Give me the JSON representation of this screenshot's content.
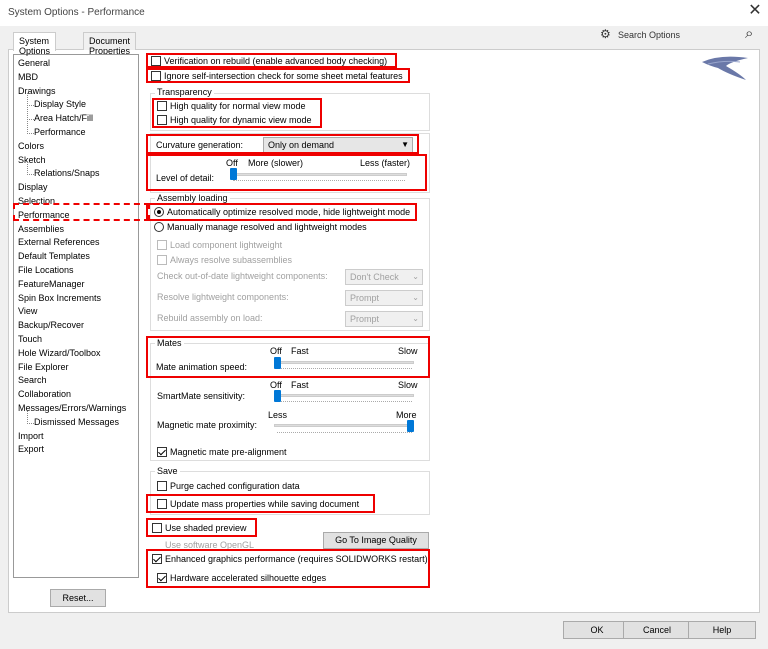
{
  "window": {
    "title": "System Options - Performance",
    "close_glyph": "✕"
  },
  "tabs": [
    {
      "label": "System Options",
      "active": true
    },
    {
      "label": "Document Properties",
      "active": false
    }
  ],
  "search": {
    "label": "Search Options",
    "icon": "gear-icon"
  },
  "tree": {
    "items": [
      {
        "label": "General",
        "sub": false
      },
      {
        "label": "MBD",
        "sub": false
      },
      {
        "label": "Drawings",
        "sub": false
      },
      {
        "label": "Display Style",
        "sub": true
      },
      {
        "label": "Area Hatch/Fill",
        "sub": true
      },
      {
        "label": "Performance",
        "sub": true
      },
      {
        "label": "Colors",
        "sub": false
      },
      {
        "label": "Sketch",
        "sub": false
      },
      {
        "label": "Relations/Snaps",
        "sub": true
      },
      {
        "label": "Display",
        "sub": false
      },
      {
        "label": "Selection",
        "sub": false
      },
      {
        "label": "Performance",
        "sub": false,
        "selected": true
      },
      {
        "label": "Assemblies",
        "sub": false
      },
      {
        "label": "External References",
        "sub": false
      },
      {
        "label": "Default Templates",
        "sub": false
      },
      {
        "label": "File Locations",
        "sub": false
      },
      {
        "label": "FeatureManager",
        "sub": false
      },
      {
        "label": "Spin Box Increments",
        "sub": false
      },
      {
        "label": "View",
        "sub": false
      },
      {
        "label": "Backup/Recover",
        "sub": false
      },
      {
        "label": "Touch",
        "sub": false
      },
      {
        "label": "Hole Wizard/Toolbox",
        "sub": false
      },
      {
        "label": "File Explorer",
        "sub": false
      },
      {
        "label": "Search",
        "sub": false
      },
      {
        "label": "Collaboration",
        "sub": false
      },
      {
        "label": "Messages/Errors/Warnings",
        "sub": false
      },
      {
        "label": "Dismissed Messages",
        "sub": true
      },
      {
        "label": "Import",
        "sub": false
      },
      {
        "label": "Export",
        "sub": false
      }
    ],
    "reset_label": "Reset..."
  },
  "options": {
    "verification": {
      "label": "Verification on rebuild (enable advanced body checking)",
      "checked": false
    },
    "ignore_self": {
      "label": "Ignore self-intersection check for some sheet metal features",
      "checked": false
    },
    "transparency": {
      "title": "Transparency",
      "high_normal": {
        "label": "High quality for normal view mode",
        "checked": false
      },
      "high_dynamic": {
        "label": "High quality for dynamic view mode",
        "checked": false
      }
    },
    "curvature": {
      "label": "Curvature generation:",
      "value": "Only on demand"
    },
    "lod": {
      "label": "Level of detail:",
      "off": "Off",
      "more": "More (slower)",
      "less": "Less (faster)",
      "level": 0
    },
    "assembly": {
      "title": "Assembly loading",
      "auto": {
        "label": "Automatically optimize resolved mode, hide lightweight mode",
        "selected": true
      },
      "manual": {
        "label": "Manually manage resolved and lightweight modes",
        "selected": false
      },
      "load_light": {
        "label": "Load component lightweight"
      },
      "always_resolve": {
        "label": "Always resolve subassemblies"
      },
      "check_out": {
        "label": "Check out-of-date lightweight components:",
        "value": "Don't Check"
      },
      "resolve_light": {
        "label": "Resolve lightweight components:",
        "value": "Prompt"
      },
      "rebuild": {
        "label": "Rebuild assembly on load:",
        "value": "Prompt"
      }
    },
    "mates": {
      "title": "Mates",
      "anim": {
        "label": "Mate animation speed:",
        "off": "Off",
        "fast": "Fast",
        "slow": "Slow",
        "level": 0
      },
      "smartmate": {
        "label": "SmartMate sensitivity:",
        "off": "Off",
        "fast": "Fast",
        "slow": "Slow",
        "level": 0
      },
      "magnetic": {
        "label": "Magnetic mate proximity:",
        "less": "Less",
        "more": "More",
        "level": 1
      },
      "prealign": {
        "label": "Magnetic mate pre-alignment",
        "checked": true
      }
    },
    "save": {
      "title": "Save",
      "purge": {
        "label": "Purge cached configuration data",
        "checked": false
      },
      "update_mass": {
        "label": "Update mass properties while saving document",
        "checked": false
      }
    },
    "shaded": {
      "label": "Use shaded preview",
      "checked": false
    },
    "opengl": {
      "label": "Use software OpenGL"
    },
    "image_quality_btn": "Go To Image Quality",
    "enhanced": {
      "label": "Enhanced graphics performance (requires SOLIDWORKS restart)",
      "checked": true
    },
    "silhouette": {
      "label": "Hardware accelerated silhouette edges",
      "checked": true
    }
  },
  "footer": {
    "ok": "OK",
    "cancel": "Cancel",
    "help": "Help"
  },
  "colors": {
    "highlight": "#e00000",
    "slider": "#0078d7"
  }
}
